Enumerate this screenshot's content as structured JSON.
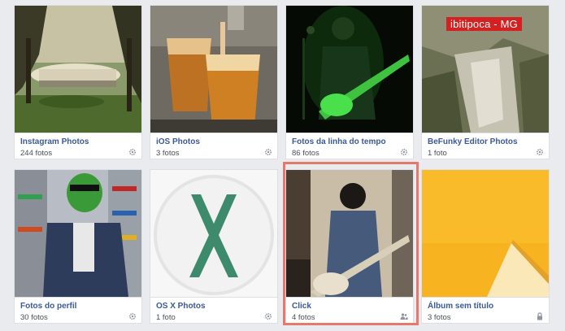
{
  "albums": [
    {
      "title": "Instagram Photos",
      "count": "244 fotos",
      "icon": "gear-icon"
    },
    {
      "title": "iOS Photos",
      "count": "3 fotos",
      "icon": "gear-icon"
    },
    {
      "title": "Fotos da linha do tempo",
      "count": "86 fotos",
      "icon": "gear-icon"
    },
    {
      "title": "BeFunky Editor Photos",
      "count": "1 foto",
      "icon": "gear-icon",
      "overlay_text": "ibitipoca - MG"
    },
    {
      "title": "Fotos do perfil",
      "count": "30 fotos",
      "icon": "gear-icon"
    },
    {
      "title": "OS X Photos",
      "count": "1 foto",
      "icon": "gear-icon"
    },
    {
      "title": "Click",
      "count": "4 fotos",
      "icon": "friends-icon"
    },
    {
      "title": "Álbum sem título",
      "count": "3 fotos",
      "icon": "lock-icon"
    }
  ],
  "colors": {
    "link": "#3b5998",
    "highlight": "#e8776c",
    "tag": "#d32020"
  }
}
